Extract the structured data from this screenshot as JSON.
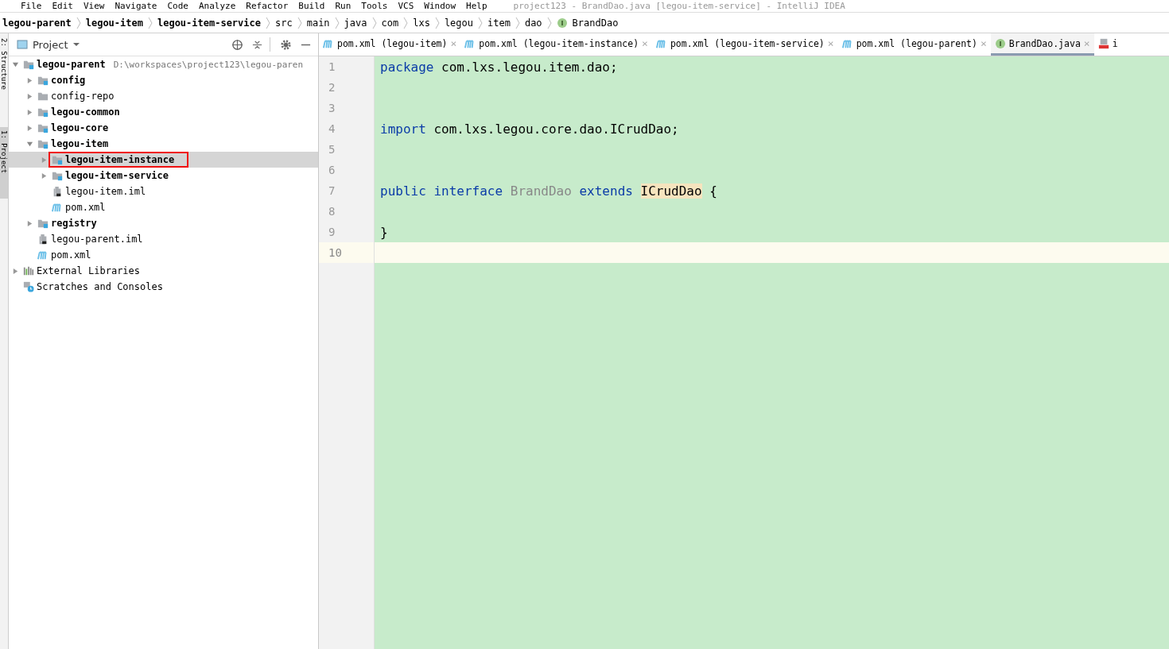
{
  "menu_bar": {
    "items": [
      "File",
      "Edit",
      "View",
      "Navigate",
      "Code",
      "Analyze",
      "Refactor",
      "Build",
      "Run",
      "Tools",
      "VCS",
      "Window",
      "Help"
    ],
    "title": "project123 - BrandDao.java [legou-item-service] - IntelliJ IDEA"
  },
  "breadcrumbs": [
    {
      "label": "legou-parent",
      "bold": true
    },
    {
      "label": "legou-item",
      "bold": true
    },
    {
      "label": "legou-item-service",
      "bold": true
    },
    {
      "label": "src",
      "bold": false
    },
    {
      "label": "main",
      "bold": false
    },
    {
      "label": "java",
      "bold": false
    },
    {
      "label": "com",
      "bold": false
    },
    {
      "label": "lxs",
      "bold": false
    },
    {
      "label": "legou",
      "bold": false
    },
    {
      "label": "item",
      "bold": false
    },
    {
      "label": "dao",
      "bold": false
    },
    {
      "label": "BrandDao",
      "bold": false,
      "kind": "interface"
    }
  ],
  "side_strip": [
    "2: Structure",
    "1: Project"
  ],
  "project_panel": {
    "title": "Project",
    "tree": [
      {
        "label": "legou-parent",
        "kind": "module",
        "bold": true,
        "expanded": true,
        "selected": false,
        "path": "D:\\workspaces\\project123\\legou-paren",
        "children": [
          {
            "label": "config",
            "kind": "module",
            "bold": true,
            "expanded": false,
            "selected": false
          },
          {
            "label": "config-repo",
            "kind": "folder",
            "bold": false,
            "expanded": false,
            "selected": false
          },
          {
            "label": "legou-common",
            "kind": "module",
            "bold": true,
            "expanded": false,
            "selected": false
          },
          {
            "label": "legou-core",
            "kind": "module",
            "bold": true,
            "expanded": false,
            "selected": false
          },
          {
            "label": "legou-item",
            "kind": "module",
            "bold": true,
            "expanded": true,
            "selected": false,
            "children": [
              {
                "label": "legou-item-instance",
                "kind": "module",
                "bold": true,
                "expanded": false,
                "selected": true,
                "marked": true
              },
              {
                "label": "legou-item-service",
                "kind": "module",
                "bold": true,
                "expanded": false,
                "selected": false
              },
              {
                "label": "legou-item.iml",
                "kind": "iml",
                "bold": false,
                "selected": false
              },
              {
                "label": "pom.xml",
                "kind": "maven",
                "bold": false,
                "selected": false
              }
            ]
          },
          {
            "label": "registry",
            "kind": "module",
            "bold": true,
            "expanded": false,
            "selected": false
          },
          {
            "label": "legou-parent.iml",
            "kind": "iml",
            "bold": false,
            "selected": false
          },
          {
            "label": "pom.xml",
            "kind": "maven",
            "bold": false,
            "selected": false
          }
        ]
      },
      {
        "label": "External Libraries",
        "kind": "libraries",
        "bold": false,
        "expanded": false,
        "selected": false
      },
      {
        "label": "Scratches and Consoles",
        "kind": "scratches",
        "bold": false,
        "selected": false
      }
    ]
  },
  "editor_tabs": [
    {
      "label": "pom.xml (legou-item)",
      "kind": "maven",
      "selected": false,
      "close": "×"
    },
    {
      "label": "pom.xml (legou-item-instance)",
      "kind": "maven",
      "selected": false,
      "close": "×"
    },
    {
      "label": "pom.xml (legou-item-service)",
      "kind": "maven",
      "selected": false,
      "close": "×"
    },
    {
      "label": "pom.xml (legou-parent)",
      "kind": "maven",
      "selected": false,
      "close": "×"
    },
    {
      "label": "BrandDao.java",
      "kind": "interface",
      "selected": true,
      "close": "×"
    },
    {
      "label": "i",
      "kind": "yml",
      "selected": false
    }
  ],
  "code": [
    {
      "number": "1",
      "current": false,
      "tokens": [
        {
          "text": "package",
          "kind": "keyword"
        },
        {
          "text": " com.lxs.legou.item.dao;",
          "kind": "plain"
        }
      ]
    },
    {
      "number": "2",
      "current": false
    },
    {
      "number": "3",
      "current": false
    },
    {
      "number": "4",
      "current": false,
      "tokens": [
        {
          "text": "import",
          "kind": "keyword"
        },
        {
          "text": " com.lxs.legou.core.dao.ICrudDao;",
          "kind": "plain"
        }
      ]
    },
    {
      "number": "5",
      "current": false
    },
    {
      "number": "6",
      "current": false
    },
    {
      "number": "7",
      "current": false,
      "tokens": [
        {
          "text": "public interface",
          "kind": "keyword"
        },
        {
          "text": " BrandDao",
          "kind": "unused"
        },
        {
          "text": " extends ",
          "kind": "keyword"
        },
        {
          "text": "ICrudDao",
          "kind": "highlight"
        },
        {
          "text": " {",
          "kind": "plain"
        }
      ]
    },
    {
      "number": "8",
      "current": false
    },
    {
      "number": "9",
      "current": false,
      "tokens": [
        {
          "text": "}",
          "kind": "plain"
        }
      ]
    },
    {
      "number": "10",
      "current": true
    }
  ]
}
